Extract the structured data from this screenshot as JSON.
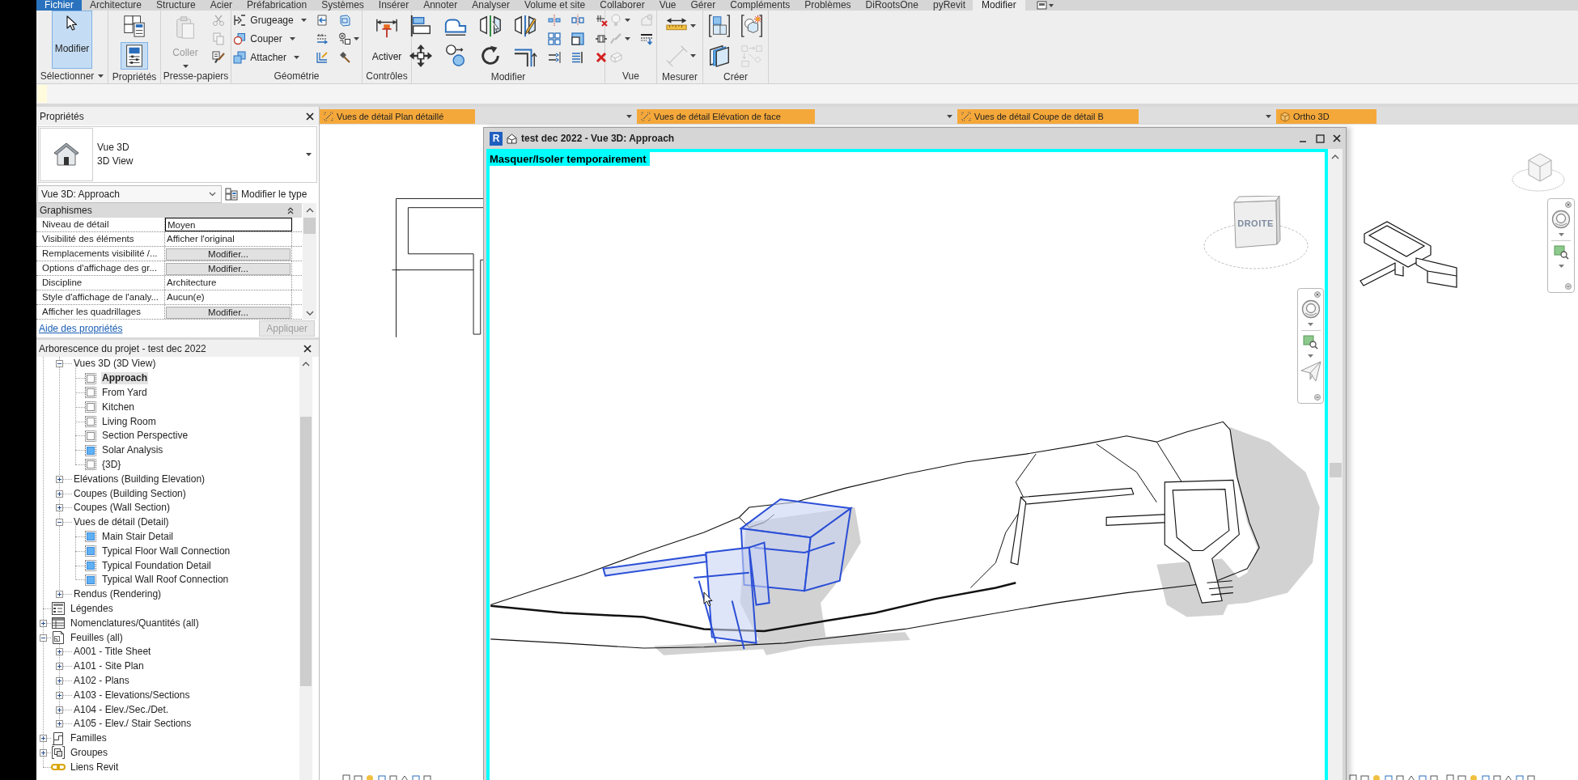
{
  "ribbon": {
    "tabs": [
      {
        "label": "Fichier",
        "kind": "file",
        "selected": false
      },
      {
        "label": "Architecture",
        "kind": "tab",
        "selected": false
      },
      {
        "label": "Structure",
        "kind": "tab",
        "selected": false
      },
      {
        "label": "Acier",
        "kind": "tab",
        "selected": false
      },
      {
        "label": "Préfabrication",
        "kind": "tab",
        "selected": false
      },
      {
        "label": "Systèmes",
        "kind": "tab",
        "selected": false
      },
      {
        "label": "Insérer",
        "kind": "tab",
        "selected": false
      },
      {
        "label": "Annoter",
        "kind": "tab",
        "selected": false
      },
      {
        "label": "Analyser",
        "kind": "tab",
        "selected": false
      },
      {
        "label": "Volume et site",
        "kind": "tab",
        "selected": false
      },
      {
        "label": "Collaborer",
        "kind": "tab",
        "selected": false
      },
      {
        "label": "Vue",
        "kind": "tab",
        "selected": false
      },
      {
        "label": "Gérer",
        "kind": "tab",
        "selected": false
      },
      {
        "label": "Compléments",
        "kind": "tab",
        "selected": false
      },
      {
        "label": "Problèmes",
        "kind": "tab",
        "selected": false
      },
      {
        "label": "DiRootsOne",
        "kind": "tab",
        "selected": false
      },
      {
        "label": "pyRevit",
        "kind": "tab",
        "selected": false
      },
      {
        "label": "Modifier",
        "kind": "tab",
        "selected": true
      }
    ],
    "panels": [
      {
        "label": "Sélectionner",
        "menu": true,
        "tools": [
          {
            "label": "Modifier",
            "pressed": true,
            "disabled": false
          }
        ]
      },
      {
        "label": "Propriétés",
        "menu": false,
        "tools": [
          {
            "pressed": false,
            "disabled": false
          },
          {
            "pressed": true,
            "disabled": false
          }
        ]
      },
      {
        "label": "Presse-papiers",
        "menu": false,
        "tools": [
          {
            "label": "Coller",
            "pressed": false,
            "disabled": true
          },
          {
            "pressed": false,
            "disabled": true
          },
          {
            "pressed": false,
            "disabled": true
          },
          {
            "pressed": false,
            "disabled": false
          }
        ]
      },
      {
        "label": "Géométrie",
        "menu": false,
        "tools": [
          {
            "label": "Grugeage",
            "pressed": false,
            "disabled": false
          },
          {
            "label": "Couper",
            "pressed": false,
            "disabled": false
          },
          {
            "label": "Attacher",
            "pressed": false,
            "disabled": false
          },
          {
            "pressed": false,
            "disabled": false
          },
          {
            "pressed": false,
            "disabled": false
          },
          {
            "pressed": false,
            "disabled": false
          },
          {
            "pressed": false,
            "disabled": false
          },
          {
            "pressed": false,
            "disabled": false
          },
          {
            "pressed": false,
            "disabled": false
          }
        ]
      },
      {
        "label": "Contrôles",
        "menu": false,
        "tools": [
          {
            "label": "Activer",
            "pressed": false,
            "disabled": false
          }
        ]
      },
      {
        "label": "Modifier",
        "menu": false,
        "tools": [
          {
            "pressed": false,
            "disabled": false
          },
          {
            "pressed": false,
            "disabled": false
          },
          {
            "pressed": false,
            "disabled": false
          },
          {
            "pressed": false,
            "disabled": false
          },
          {
            "pressed": false,
            "disabled": false
          },
          {
            "pressed": false,
            "disabled": false
          },
          {
            "pressed": false,
            "disabled": false
          },
          {
            "pressed": false,
            "disabled": false
          },
          {
            "pressed": false,
            "disabled": false
          },
          {
            "pressed": false,
            "disabled": false
          },
          {
            "pressed": false,
            "disabled": false
          },
          {
            "pressed": false,
            "disabled": false
          },
          {
            "pressed": false,
            "disabled": false
          },
          {
            "pressed": false,
            "disabled": false
          },
          {
            "pressed": false,
            "disabled": false
          },
          {
            "pressed": false,
            "disabled": false
          },
          {
            "pressed": false,
            "disabled": false
          }
        ]
      },
      {
        "label": "Vue",
        "menu": false,
        "tools": [
          {
            "pressed": false,
            "disabled": true
          },
          {
            "pressed": false,
            "disabled": true
          },
          {
            "pressed": false,
            "disabled": true
          },
          {
            "pressed": false,
            "disabled": true
          },
          {
            "pressed": false,
            "disabled": false
          }
        ]
      },
      {
        "label": "Mesurer",
        "menu": false,
        "tools": [
          {
            "pressed": false,
            "disabled": false
          },
          {
            "pressed": false,
            "disabled": true
          }
        ]
      },
      {
        "label": "Créer",
        "menu": false,
        "tools": [
          {
            "pressed": false,
            "disabled": false
          },
          {
            "pressed": false,
            "disabled": false
          },
          {
            "pressed": false,
            "disabled": false
          },
          {
            "pressed": false,
            "disabled": true
          }
        ]
      }
    ]
  },
  "properties": {
    "title": "Propriétés",
    "type": {
      "family": "Vue 3D",
      "name": "3D View"
    },
    "instance": "Vue 3D: Approach",
    "edit_type": "Modifier le type",
    "group": {
      "label": "Graphismes",
      "expanded": true
    },
    "rows": [
      {
        "name": "Niveau de détail",
        "value": "Moyen",
        "kind": "text",
        "focused": true
      },
      {
        "name": "Visibilité des éléments",
        "value": "Afficher l'original",
        "kind": "text",
        "focused": false
      },
      {
        "name": "Remplacements visibilité /...",
        "value": "Modifier...",
        "kind": "button",
        "focused": false
      },
      {
        "name": "Options d'affichage des gr...",
        "value": "Modifier...",
        "kind": "button",
        "focused": false
      },
      {
        "name": "Discipline",
        "value": "Architecture",
        "kind": "text",
        "focused": false
      },
      {
        "name": "Style d'affichage de l'analy...",
        "value": "Aucun(e)",
        "kind": "text",
        "focused": false
      },
      {
        "name": "Afficher les quadrillages",
        "value": "Modifier...",
        "kind": "button",
        "focused": false
      }
    ],
    "help_link": "Aide des propriétés",
    "apply": {
      "label": "Appliquer",
      "disabled": true
    }
  },
  "project_browser": {
    "title": "Arborescence du projet - test dec 2022",
    "tree": [
      {
        "children": [
          {
            "label": "Vues 3D (3D View)",
            "kind": "folder",
            "selected": false,
            "expanded": true,
            "children": [
              {
                "label": "Approach",
                "kind": "view",
                "selected": true,
                "on_sheet": false
              },
              {
                "label": "From Yard",
                "kind": "view",
                "selected": false,
                "on_sheet": false
              },
              {
                "label": "Kitchen",
                "kind": "view",
                "selected": false,
                "on_sheet": false
              },
              {
                "label": "Living Room",
                "kind": "view",
                "selected": false,
                "on_sheet": false
              },
              {
                "label": "Section Perspective",
                "kind": "view",
                "selected": false,
                "on_sheet": false
              },
              {
                "label": "Solar Analysis",
                "kind": "view",
                "selected": false,
                "on_sheet": true
              },
              {
                "label": "{3D}",
                "kind": "view",
                "selected": false,
                "on_sheet": false
              }
            ]
          },
          {
            "label": "Elévations (Building Elevation)",
            "kind": "folder",
            "selected": false,
            "expanded": false
          },
          {
            "label": "Coupes (Building Section)",
            "kind": "folder",
            "selected": false,
            "expanded": false
          },
          {
            "label": "Coupes (Wall Section)",
            "kind": "folder",
            "selected": false,
            "expanded": false
          },
          {
            "label": "Vues de détail (Detail)",
            "kind": "folder",
            "selected": false,
            "expanded": true,
            "children": [
              {
                "label": "Main Stair Detail",
                "kind": "view",
                "selected": false,
                "on_sheet": true
              },
              {
                "label": "Typical Floor Wall Connection",
                "kind": "view",
                "selected": false,
                "on_sheet": true
              },
              {
                "label": "Typical Foundation Detail",
                "kind": "view",
                "selected": false,
                "on_sheet": true
              },
              {
                "label": "Typical Wall Roof Connection",
                "kind": "view",
                "selected": false,
                "on_sheet": true
              }
            ]
          },
          {
            "label": "Rendus (Rendering)",
            "kind": "folder",
            "selected": false,
            "expanded": false
          }
        ]
      },
      {
        "label": "Légendes",
        "kind": "legends",
        "selected": false
      },
      {
        "label": "Nomenclatures/Quantités (all)",
        "kind": "schedules",
        "selected": false,
        "expanded": false
      },
      {
        "label": "Feuilles (all)",
        "kind": "sheets",
        "selected": false,
        "expanded": true,
        "children": [
          {
            "label": "A001 - Title Sheet",
            "kind": "folder",
            "selected": false,
            "expanded": false
          },
          {
            "label": "A101 - Site Plan",
            "kind": "folder",
            "selected": false,
            "expanded": false
          },
          {
            "label": "A102 - Plans",
            "kind": "folder",
            "selected": false,
            "expanded": false
          },
          {
            "label": "A103 - Elevations/Sections",
            "kind": "folder",
            "selected": false,
            "expanded": false
          },
          {
            "label": "A104 - Elev./Sec./Det.",
            "kind": "folder",
            "selected": false,
            "expanded": false
          },
          {
            "label": "A105 - Elev./ Stair Sections",
            "kind": "folder",
            "selected": false,
            "expanded": false
          }
        ]
      },
      {
        "label": "Familles",
        "kind": "families",
        "selected": false,
        "expanded": false
      },
      {
        "label": "Groupes",
        "kind": "groups",
        "selected": false,
        "expanded": false
      },
      {
        "label": "Liens Revit",
        "kind": "links",
        "selected": false
      }
    ]
  },
  "view_tabs": [
    {
      "label": "Vues de détail Plan détaillé",
      "kind": "detail",
      "selected": true
    },
    {
      "label": "Vues de détail Elévation de face",
      "kind": "detail",
      "selected": true
    },
    {
      "label": "Vues de détail Coupe de détail B",
      "kind": "detail",
      "selected": true
    },
    {
      "label": "Ortho 3D",
      "kind": "model",
      "selected": true
    }
  ],
  "view_window": {
    "badge": "R",
    "title": "test dec 2022 - Vue 3D: Approach",
    "banner": "Masquer/Isoler temporairement",
    "view_cube": {
      "face": "DROITE"
    },
    "model": {
      "building_selected": true
    }
  }
}
